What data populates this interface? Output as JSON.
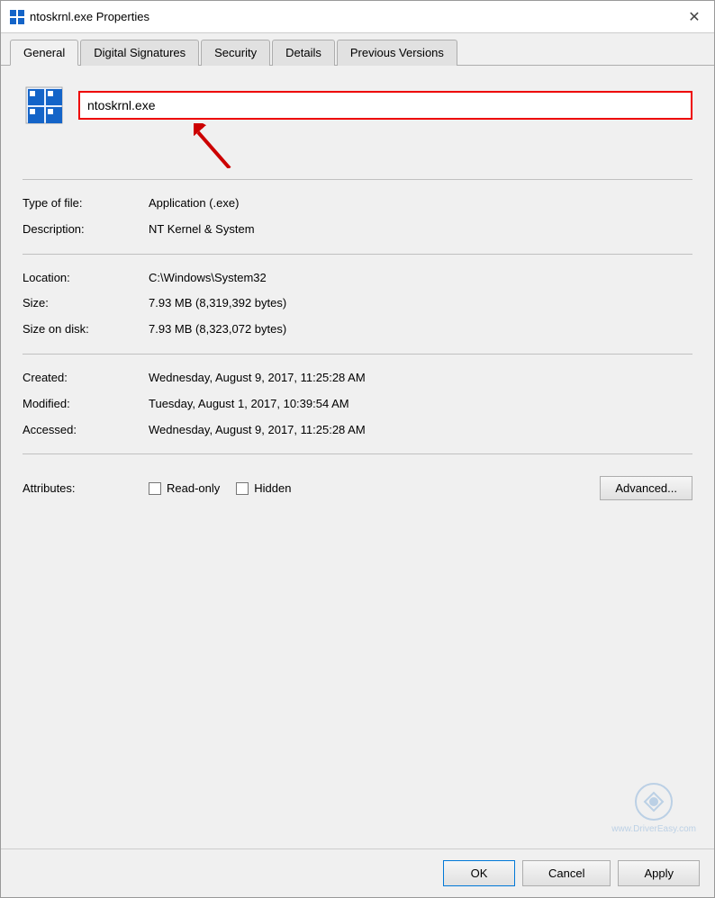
{
  "titleBar": {
    "icon": "file-properties-icon",
    "title": "ntoskrnl.exe Properties",
    "closeLabel": "✕"
  },
  "tabs": [
    {
      "label": "General",
      "active": true
    },
    {
      "label": "Digital Signatures",
      "active": false
    },
    {
      "label": "Security",
      "active": false
    },
    {
      "label": "Details",
      "active": false
    },
    {
      "label": "Previous Versions",
      "active": false
    }
  ],
  "fileSection": {
    "filename": "ntoskrnl.exe"
  },
  "properties": [
    {
      "label": "Type of file:",
      "value": "Application (.exe)"
    },
    {
      "label": "Description:",
      "value": "NT Kernel & System"
    }
  ],
  "locationSection": [
    {
      "label": "Location:",
      "value": "C:\\Windows\\System32"
    },
    {
      "label": "Size:",
      "value": "7.93 MB (8,319,392 bytes)"
    },
    {
      "label": "Size on disk:",
      "value": "7.93 MB (8,323,072 bytes)"
    }
  ],
  "dateSection": [
    {
      "label": "Created:",
      "value": "Wednesday, August 9, 2017, 11:25:28 AM"
    },
    {
      "label": "Modified:",
      "value": "Tuesday, August 1, 2017, 10:39:54 AM"
    },
    {
      "label": "Accessed:",
      "value": "Wednesday, August 9, 2017, 11:25:28 AM"
    }
  ],
  "attributes": {
    "label": "Attributes:",
    "readOnly": {
      "label": "Read-only",
      "checked": false
    },
    "hidden": {
      "label": "Hidden",
      "checked": false
    },
    "advancedButton": "Advanced..."
  },
  "buttons": {
    "ok": "OK",
    "cancel": "Cancel",
    "apply": "Apply"
  },
  "watermark": {
    "text": "www.DriverEasy.com"
  }
}
